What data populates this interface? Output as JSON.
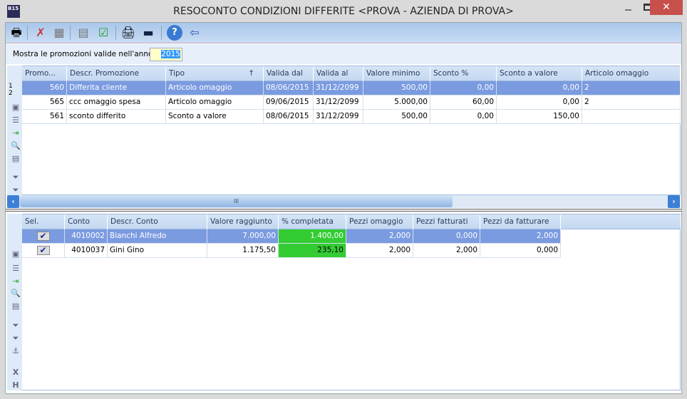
{
  "window": {
    "title": "RESOCONTO CONDIZIONI DIFFERITE <PROVA - AZIENDA DI PROVA>",
    "app_icon": "B15",
    "close": "✕"
  },
  "toolbar": [
    "print-preview-icon",
    "delete-icon",
    "calculator-icon",
    "document-icon",
    "checked-document-icon",
    "printer-icon",
    "monitor-icon",
    "help-icon",
    "exit-icon"
  ],
  "filter": {
    "label": "Mostra le promozioni valide nell'anno",
    "year": "2015"
  },
  "promotions": {
    "row_numbers": [
      "1",
      "2"
    ],
    "columns": [
      "Promo...",
      "Descr. Promozione",
      "Tipo",
      "Valida dal",
      "Valida al",
      "Valore minimo",
      "Sconto %",
      "Sconto a valore",
      "Articolo omaggio"
    ],
    "sort_indicator": "↑",
    "rows": [
      [
        "560",
        "Differita cliente",
        "Articolo omaggio",
        "08/06/2015",
        "31/12/2099",
        "500,00",
        "0,00",
        "0,00",
        "2"
      ],
      [
        "565",
        "ccc omaggio spesa",
        "Articolo omaggio",
        "09/06/2015",
        "31/12/2099",
        "5.000,00",
        "60,00",
        "0,00",
        "2"
      ],
      [
        "561",
        "sconto differito",
        "Sconto a valore",
        "08/06/2015",
        "31/12/2099",
        "500,00",
        "0,00",
        "150,00",
        ""
      ]
    ],
    "selected_row": 0,
    "scroll_thumb": "III"
  },
  "accounts": {
    "columns": [
      "Sel.",
      "Conto",
      "Descr. Conto",
      "Valore raggiunto",
      "% completata",
      "Pezzi omaggio",
      "Pezzi fatturati",
      "Pezzi da fatturare"
    ],
    "rows": [
      [
        true,
        "4010002",
        "Bianchi Alfredo",
        "7.000,00",
        "1.400,00",
        "2,000",
        "0,000",
        "2,000"
      ],
      [
        true,
        "4010037",
        "Gini Gino",
        "1.175,50",
        "235,10",
        "2,000",
        "2,000",
        "0,000"
      ]
    ],
    "selected_row": 0,
    "highlight_color": "#33cc33"
  },
  "colors": {
    "selection": "#7b9be0",
    "toolbar": "#b8d1ef"
  }
}
